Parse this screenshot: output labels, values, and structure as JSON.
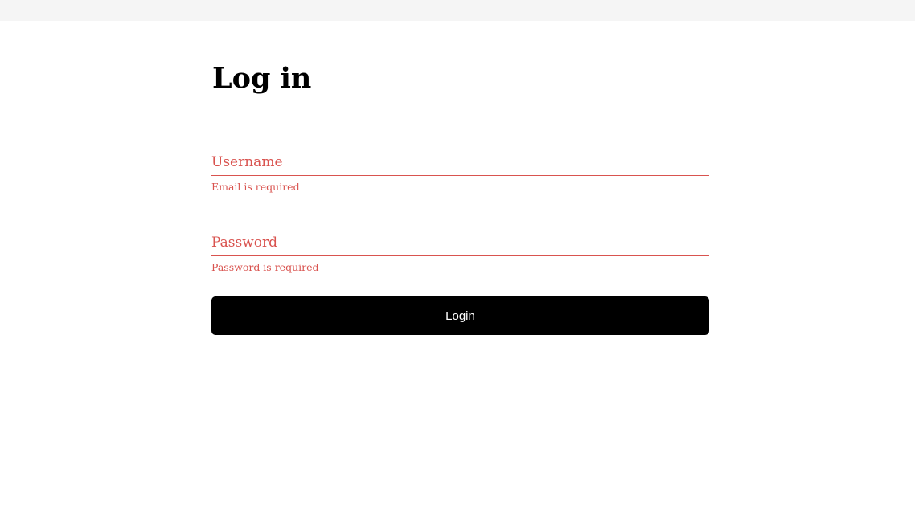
{
  "page": {
    "title": "Log in"
  },
  "form": {
    "username": {
      "placeholder": "Username",
      "value": "",
      "error": "Email is required"
    },
    "password": {
      "placeholder": "Password",
      "value": "",
      "error": "Password is required"
    },
    "submit_label": "Login"
  },
  "colors": {
    "error": "#d9534f",
    "button_bg": "#000000",
    "button_text": "#ffffff",
    "topbar_bg": "#f5f5f5"
  }
}
